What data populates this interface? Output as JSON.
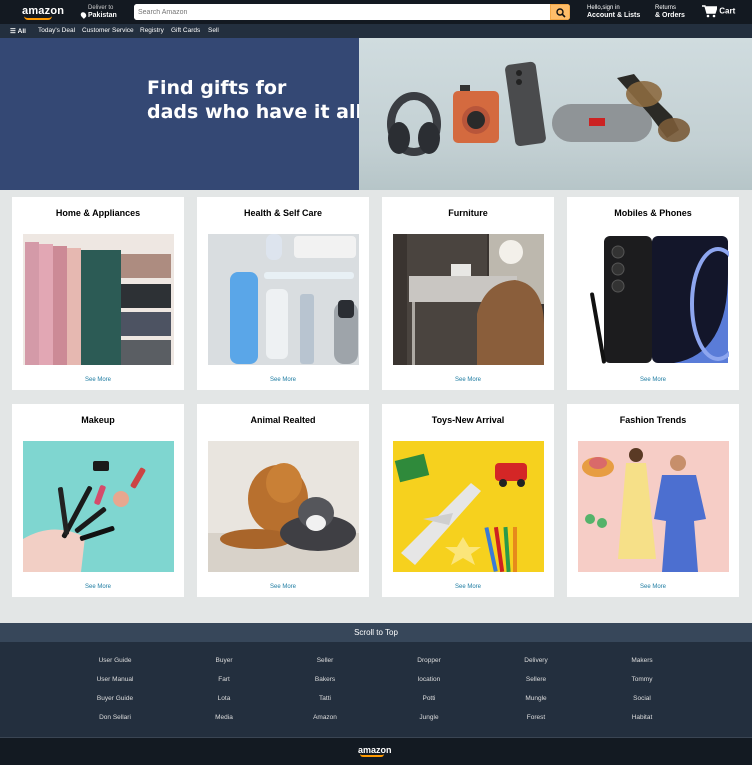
{
  "header": {
    "logo": "amazon",
    "deliver_line1": "Deliver to",
    "deliver_line2": "Pakistan",
    "search_placeholder": "Search Amazon",
    "account_line1": "Hello,sign in",
    "account_line2": "Account & Lists",
    "returns_line1": "Returns",
    "returns_line2": "& Orders",
    "cart": "Cart"
  },
  "nav": {
    "all": "All",
    "items": [
      "Today's Deal",
      "Customer Service",
      "Registry",
      "Gift Cards",
      "Sell"
    ]
  },
  "hero": {
    "line1": "Find gifts for",
    "line2": "dads who have it all"
  },
  "cards": [
    {
      "title": "Home & Appliances",
      "link": "See More"
    },
    {
      "title": "Health & Self Care",
      "link": "See More"
    },
    {
      "title": "Furniture",
      "link": "See More"
    },
    {
      "title": "Mobiles & Phones",
      "link": "See More"
    },
    {
      "title": "Makeup",
      "link": "See More"
    },
    {
      "title": "Animal Realted",
      "link": "See More"
    },
    {
      "title": "Toys-New Arrival",
      "link": "See More"
    },
    {
      "title": "Fashion Trends",
      "link": "See More"
    }
  ],
  "scroll_top": "Scroll to Top",
  "footer": {
    "columns": [
      [
        "User Guide",
        "User Manual",
        "Buyer Guide",
        "Don Sellari"
      ],
      [
        "Buyer",
        "Fart",
        "Lota",
        "Media"
      ],
      [
        "Seller",
        "Bakers",
        "Tatti",
        "Amazon"
      ],
      [
        "Dropper",
        "location",
        "Potti",
        "Jungle"
      ],
      [
        "Delivery",
        "Sellere",
        "Mungle",
        "Forest"
      ],
      [
        "Makers",
        "Tommy",
        "Social",
        "Habitat"
      ]
    ]
  },
  "bottom_logo": "amazon",
  "colors": {
    "accent": "#febd69",
    "nav_dark": "#131921",
    "nav": "#232f3e",
    "hero": "#344874",
    "link": "#1e7ca2"
  }
}
